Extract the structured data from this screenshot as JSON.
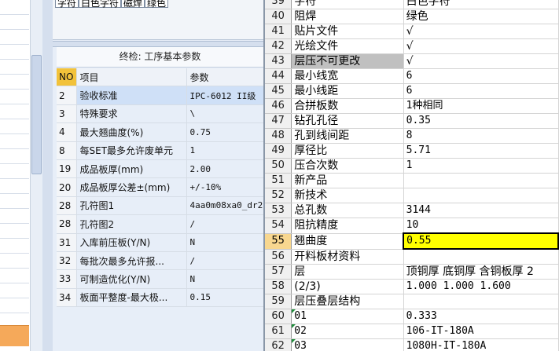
{
  "top_cells": [
    "字符",
    "白色字符",
    "磁焊",
    "绿色"
  ],
  "panel": {
    "title": "终检: 工序基本参数",
    "headers": [
      "NO",
      "项目",
      "参数"
    ],
    "rows": [
      {
        "no": "2",
        "item": "验收标准",
        "param": "IPC-6012 II级",
        "selected": true
      },
      {
        "no": "3",
        "item": "特殊要求",
        "param": "\\"
      },
      {
        "no": "4",
        "item": "最大翘曲度(%)",
        "param": "0.75"
      },
      {
        "no": "8",
        "item": "每SET最多允许废单元",
        "param": "1"
      },
      {
        "no": "19",
        "item": "成品板厚(mm)",
        "param": "2.00"
      },
      {
        "no": "20",
        "item": "成品板厚公差±(mm)",
        "param": "+/-10%"
      },
      {
        "no": "28",
        "item": "孔符图1",
        "param": "4aa0m08xa0_dr2"
      },
      {
        "no": "28",
        "item": "孔符图2",
        "param": "/"
      },
      {
        "no": "31",
        "item": "入库前压板(Y/N)",
        "param": "N"
      },
      {
        "no": "32",
        "item": "每批次最多允许报...",
        "param": "/"
      },
      {
        "no": "33",
        "item": "可制造优化(Y/N)",
        "param": "N"
      },
      {
        "no": "34",
        "item": "板面平整度-最大极...",
        "param": "0.15"
      }
    ]
  },
  "sheet": {
    "rows": [
      {
        "row": "39",
        "a": "字符",
        "b": "白色字符"
      },
      {
        "row": "40",
        "a": "阻焊",
        "b": "绿色"
      },
      {
        "row": "41",
        "a": "贴片文件",
        "b": "√"
      },
      {
        "row": "42",
        "a": "光绘文件",
        "b": "√"
      },
      {
        "row": "43",
        "a": "层压不可更改",
        "b": "√"
      },
      {
        "row": "44",
        "a": "最小线宽",
        "b": "6"
      },
      {
        "row": "45",
        "a": "最小线距",
        "b": "6"
      },
      {
        "row": "46",
        "a": "合拼板数",
        "b": "1种相同"
      },
      {
        "row": "47",
        "a": "钻孔孔径",
        "b": "0.35"
      },
      {
        "row": "48",
        "a": "孔到线间距",
        "b": "8"
      },
      {
        "row": "49",
        "a": "厚径比",
        "b": "5.71"
      },
      {
        "row": "50",
        "a": "压合次数",
        "b": "1"
      },
      {
        "row": "51",
        "a": "新产品",
        "b": ""
      },
      {
        "row": "52",
        "a": "新技术",
        "b": ""
      },
      {
        "row": "53",
        "a": "总孔数",
        "b": "3144"
      },
      {
        "row": "54",
        "a": "阻抗精度",
        "b": "10"
      },
      {
        "row": "55",
        "a": "翘曲度",
        "b": "0.55"
      },
      {
        "row": "56",
        "a": "开料板材资料",
        "b": ""
      },
      {
        "row": "57",
        "a": "层",
        "b": "顶铜厚 底铜厚 含铜板厚 2"
      },
      {
        "row": "58",
        "a": "(2/3)",
        "b": "1.000  1.000   1.600"
      },
      {
        "row": "59",
        "a": "层压叠层结构",
        "b": ""
      },
      {
        "row": "60",
        "a": "01",
        "b": "0.333"
      },
      {
        "row": "61",
        "a": "02",
        "b": "106-IT-180A"
      },
      {
        "row": "62",
        "a": "03",
        "b": "1080H-IT-180A"
      }
    ],
    "selected_row": "55"
  },
  "colors": {
    "yellow_cell": "#ffff00",
    "grey_cell": "#c0c0c0",
    "header_highlight": "#f2c23a"
  }
}
